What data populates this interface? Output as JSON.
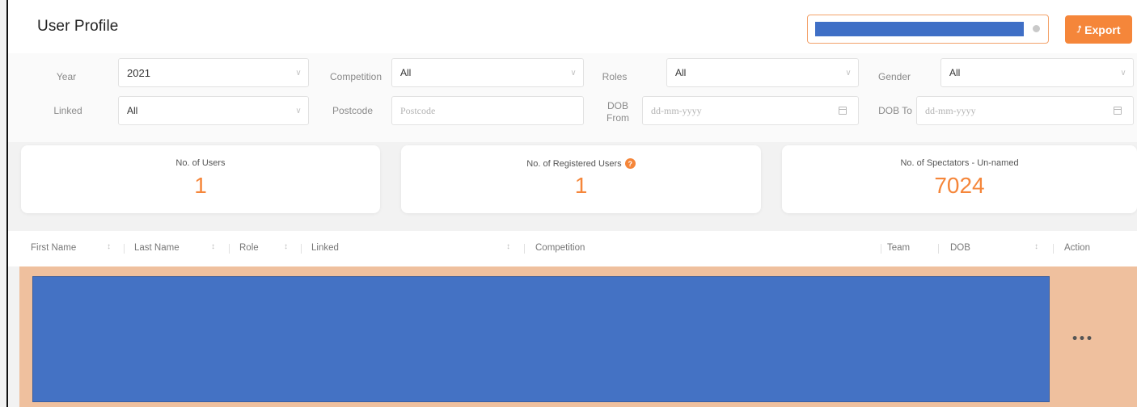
{
  "header": {
    "title": "User Profile",
    "search_value": "",
    "export_label": "Export",
    "export_icon": "double-chevron-up-icon",
    "accent_color": "#f5863a"
  },
  "filters": {
    "year": {
      "label": "Year",
      "value": "2021"
    },
    "competition": {
      "label": "Competition",
      "value": "All"
    },
    "roles": {
      "label": "Roles",
      "value": "All"
    },
    "gender": {
      "label": "Gender",
      "value": "All"
    },
    "linked": {
      "label": "Linked",
      "value": "All"
    },
    "postcode": {
      "label": "Postcode",
      "placeholder": "Postcode"
    },
    "dob_from": {
      "label_line1": "DOB",
      "label_line2": "From",
      "placeholder": "dd-mm-yyyy"
    },
    "dob_to": {
      "label": "DOB To",
      "placeholder": "dd-mm-yyyy"
    }
  },
  "stats": [
    {
      "label": "No. of Users",
      "value": "1"
    },
    {
      "label": "No. of Registered Users",
      "value": "1"
    },
    {
      "label": "No. of Spectators - Un-named",
      "value": "7024"
    }
  ],
  "table": {
    "columns": [
      "First Name",
      "Last Name",
      "Role",
      "Linked",
      "Competition",
      "Team",
      "DOB",
      "Action"
    ],
    "action_label": "•••",
    "row_highlight_color": "#efc09e"
  }
}
